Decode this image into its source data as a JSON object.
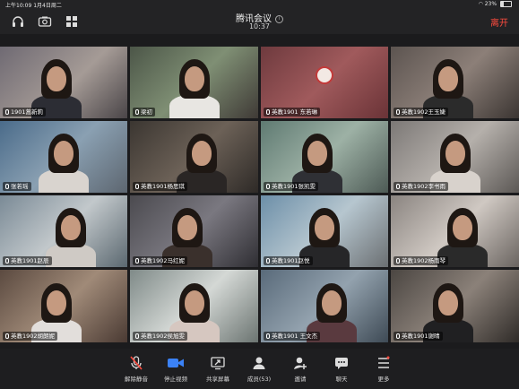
{
  "status": {
    "time_date": "上午10:09  1月4日周二",
    "battery": "23%"
  },
  "header": {
    "title": "腾讯会议",
    "info_icon": "i",
    "time": "10:37",
    "leave": "离开"
  },
  "participants": [
    "1901蒿新莉",
    "梁初",
    "英教1901 东若琳",
    "英教1902王玉婕",
    "张若瑶",
    "英教1901杨思琪",
    "英教1901张凯雯",
    "英教1902李书雨",
    "英教1901赵辰",
    "英教1902马红妮",
    "英教1901赵悦",
    "英教1902杨雨琴",
    "英教1902胡朗妮",
    "英教1902侯旭雯",
    "英教1901 王文杰",
    "英教1901谢晴"
  ],
  "toolbar": {
    "mute": "解除静音",
    "video": "停止视频",
    "share": "共享屏幕",
    "members": "成员(53)",
    "invite": "邀请",
    "chat": "聊天",
    "more": "更多"
  },
  "colors": {
    "leave": "#ff4b3e",
    "active_speaker": "#3ad04a",
    "video_accent": "#3b82f6"
  }
}
